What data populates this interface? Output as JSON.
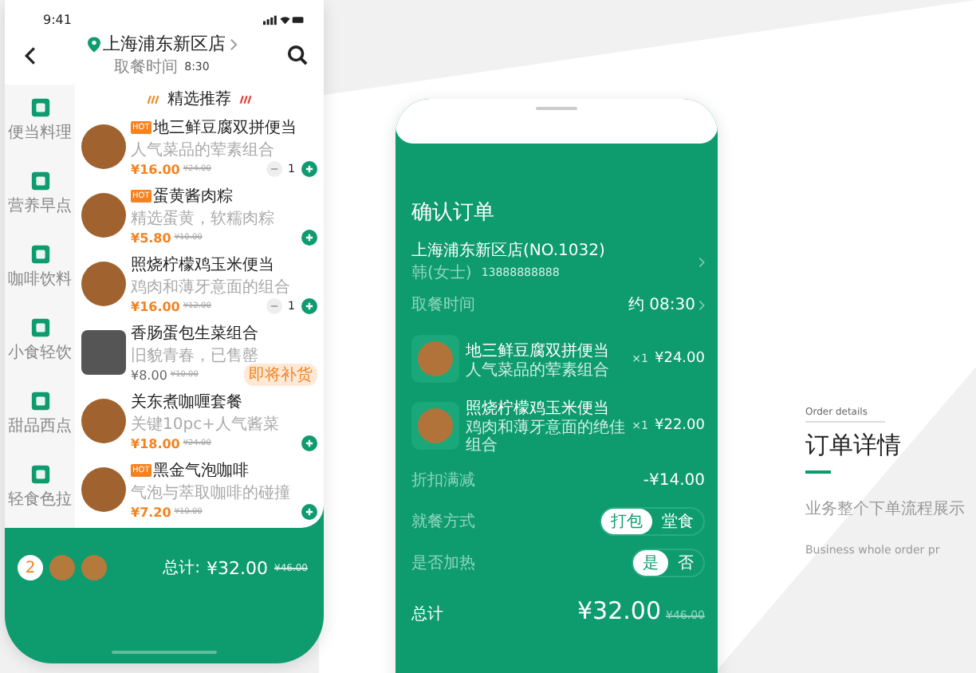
{
  "left_phone": {
    "status_time": "9:41",
    "store": "上海浦东新区店",
    "pickup_label": "取餐时间",
    "pickup_time": "8:30",
    "section_title": "精选推荐",
    "categories": [
      {
        "label": "便当料理"
      },
      {
        "label": "营养早点"
      },
      {
        "label": "咖啡饮料"
      },
      {
        "label": "小食轻饮"
      },
      {
        "label": "甜品西点"
      },
      {
        "label": "轻食色拉"
      }
    ],
    "items": [
      {
        "kind": "stepper",
        "badge": "HOT",
        "name": "地三鲜豆腐双拼便当",
        "desc": "人气菜品的荤素组合",
        "price": "¥16.00",
        "old_price": "¥24.00",
        "qty": "1"
      },
      {
        "kind": "add",
        "badge": "HOT",
        "name": "蛋黄酱肉粽",
        "desc": "精选蛋黄，软糯肉粽",
        "price": "¥5.80",
        "old_price": "¥10.00"
      },
      {
        "kind": "stepper",
        "name": "照烧柠檬鸡玉米便当",
        "desc": "鸡肉和薄牙意面的组合",
        "price": "¥16.00",
        "old_price": "¥12.00",
        "qty": "1"
      },
      {
        "kind": "notice",
        "name": "香肠蛋包生菜组合",
        "desc": "旧貌青春，已售罄",
        "price": "¥8.00",
        "old_price": "¥10.00",
        "notice": "即将补货"
      },
      {
        "kind": "add",
        "name": "关东煮咖喱套餐",
        "desc": "关键10pc+人气酱菜",
        "price": "¥18.00",
        "old_price": "¥24.00"
      },
      {
        "kind": "add",
        "badge": "HOT",
        "name": "黑金气泡咖啡",
        "desc": "气泡与萃取咖啡的碰撞",
        "price": "¥7.20",
        "old_price": "¥10.00"
      }
    ],
    "cart": {
      "count": "2",
      "total_label": "总计:",
      "total": "¥32.00",
      "old_total": "¥46.00"
    }
  },
  "right_phone": {
    "title": "确认订单",
    "store": "上海浦东新区店(NO.1032)",
    "contact_name": "韩(女士)",
    "phone": "13888888888",
    "pickup_label": "取餐时间",
    "pickup_time": "约 08:30",
    "items": [
      {
        "name": "地三鲜豆腐双拼便当",
        "desc": "人气菜品的荤素组合",
        "qty": "×1",
        "price": "¥24.00"
      },
      {
        "name": "照烧柠檬鸡玉米便当",
        "desc": "鸡肉和薄牙意面的绝佳组合",
        "qty": "×1",
        "price": "¥22.00"
      }
    ],
    "discount_label": "折扣满减",
    "discount": "-¥14.00",
    "options": [
      {
        "label": "就餐方式",
        "choices": [
          {
            "label": "打包",
            "selected": true
          },
          {
            "label": "堂食",
            "selected": false
          }
        ]
      },
      {
        "label": "是否加热",
        "choices": [
          {
            "label": "是",
            "selected": true
          },
          {
            "label": "否",
            "selected": false
          }
        ]
      }
    ],
    "total_label": "总计",
    "total": "¥32.00",
    "old_total": "¥46.00"
  },
  "side_text": {
    "caption": "Order details",
    "title": "订单详情",
    "subtitle": "业务整个下单流程展示",
    "subtitle_en": "Business whole order pr"
  }
}
